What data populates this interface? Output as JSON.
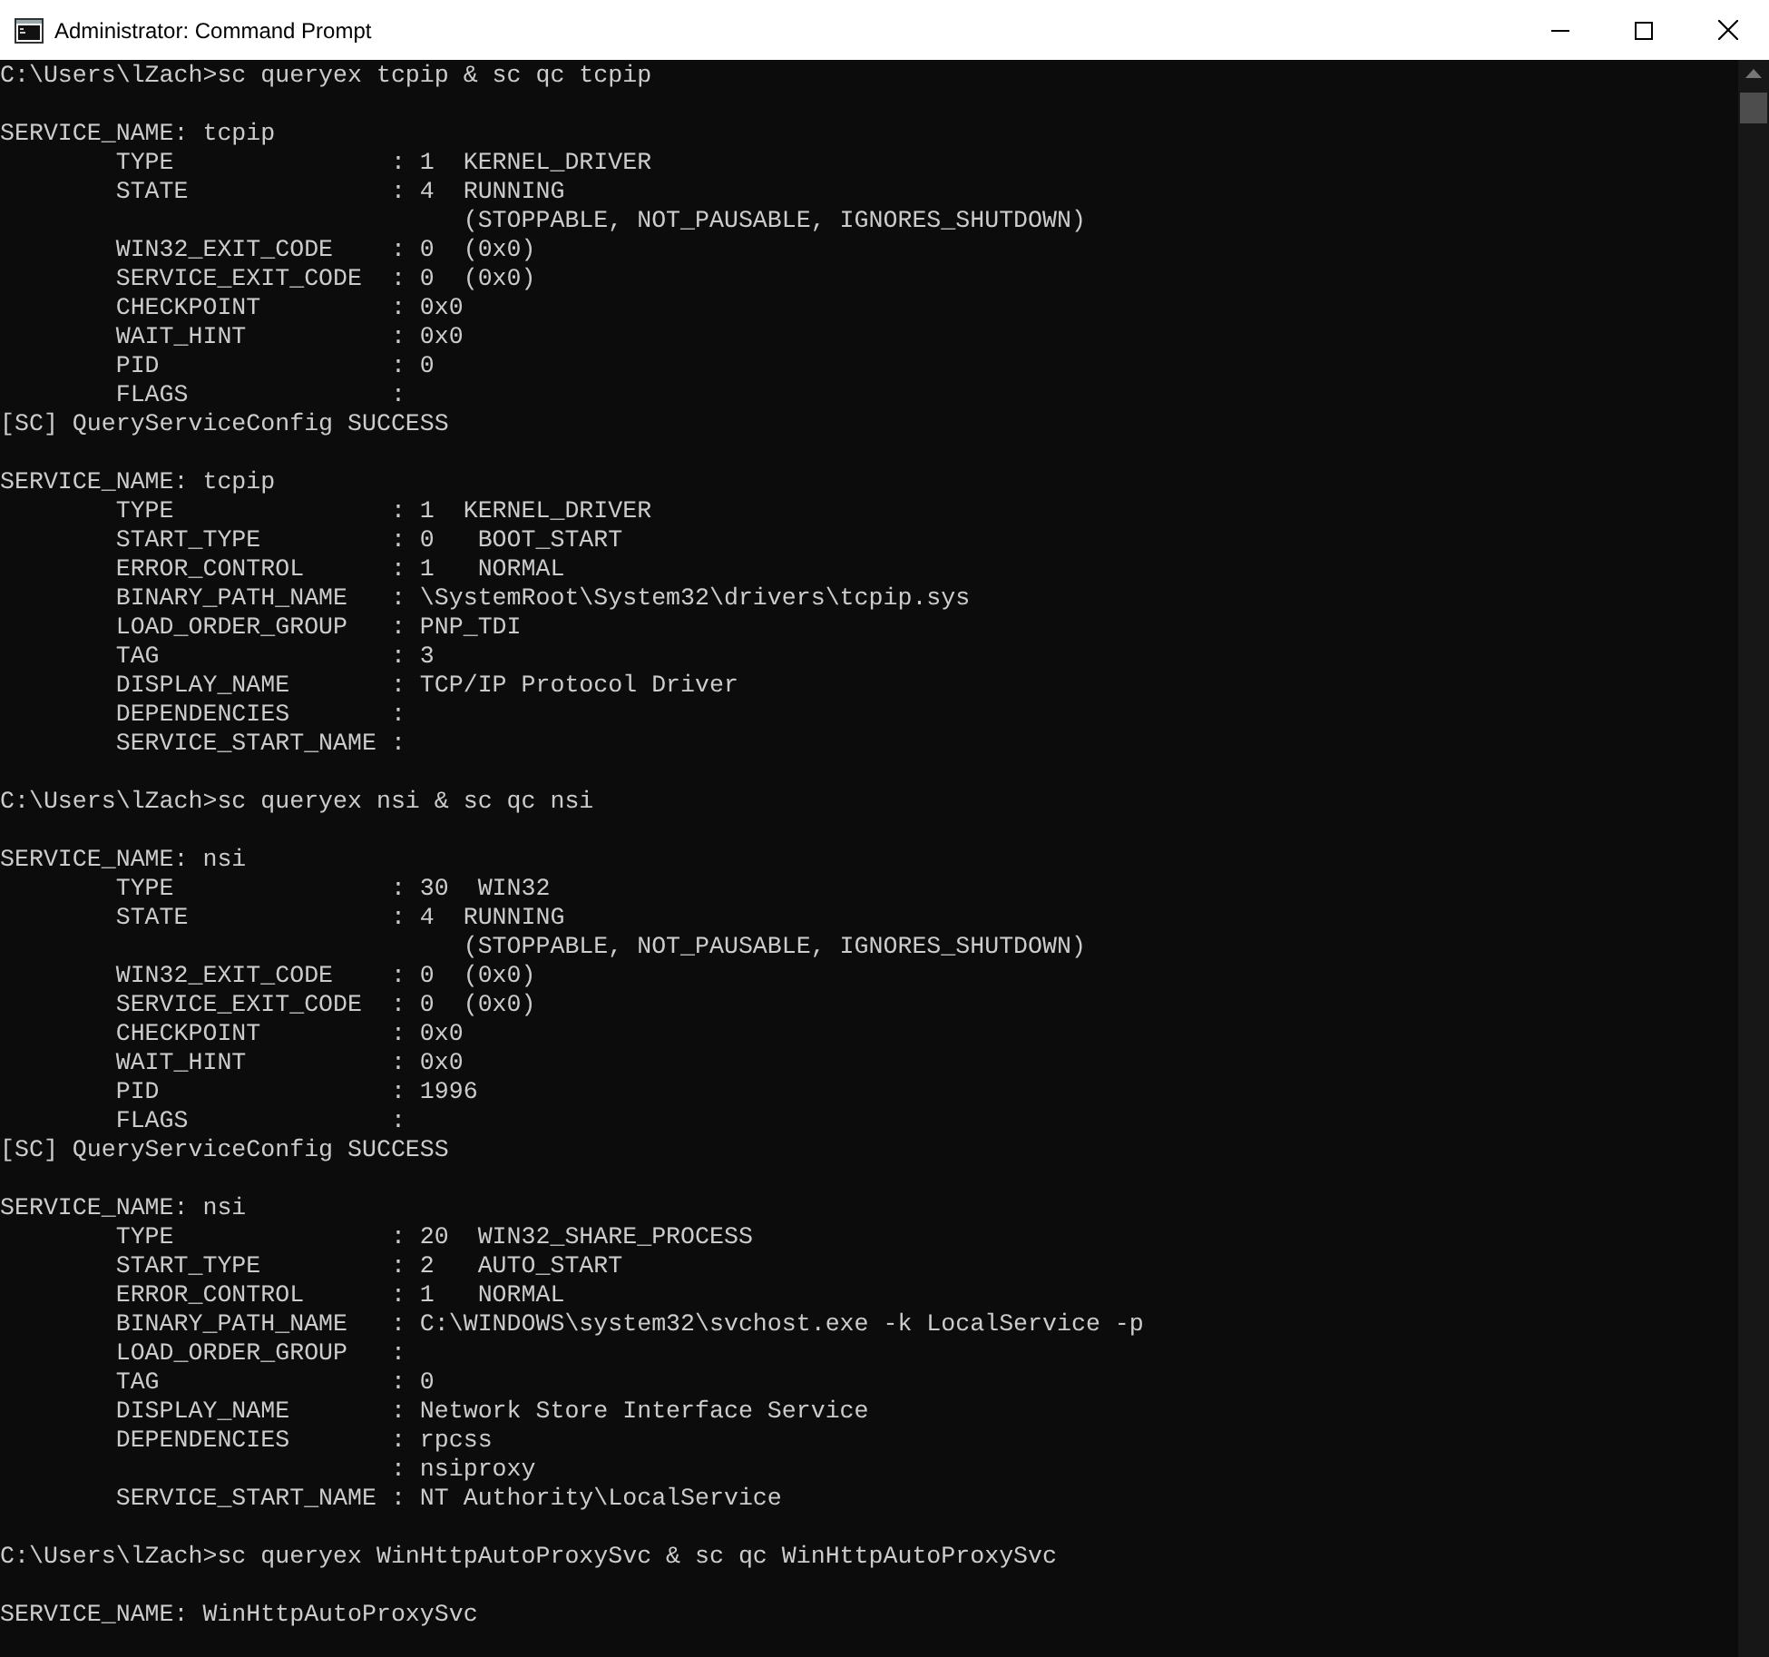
{
  "window": {
    "title": "Administrator: Command Prompt"
  },
  "console": {
    "blocks": [
      [
        "C:\\Users\\lZach>sc queryex tcpip & sc qc tcpip"
      ],
      [
        "SERVICE_NAME: tcpip",
        "        TYPE               : 1  KERNEL_DRIVER",
        "        STATE              : 4  RUNNING",
        "                                (STOPPABLE, NOT_PAUSABLE, IGNORES_SHUTDOWN)",
        "        WIN32_EXIT_CODE    : 0  (0x0)",
        "        SERVICE_EXIT_CODE  : 0  (0x0)",
        "        CHECKPOINT         : 0x0",
        "        WAIT_HINT          : 0x0",
        "        PID                : 0",
        "        FLAGS              :",
        "[SC] QueryServiceConfig SUCCESS"
      ],
      [
        "SERVICE_NAME: tcpip",
        "        TYPE               : 1  KERNEL_DRIVER",
        "        START_TYPE         : 0   BOOT_START",
        "        ERROR_CONTROL      : 1   NORMAL",
        "        BINARY_PATH_NAME   : \\SystemRoot\\System32\\drivers\\tcpip.sys",
        "        LOAD_ORDER_GROUP   : PNP_TDI",
        "        TAG                : 3",
        "        DISPLAY_NAME       : TCP/IP Protocol Driver",
        "        DEPENDENCIES       :",
        "        SERVICE_START_NAME :"
      ],
      [
        "C:\\Users\\lZach>sc queryex nsi & sc qc nsi"
      ],
      [
        "SERVICE_NAME: nsi",
        "        TYPE               : 30  WIN32",
        "        STATE              : 4  RUNNING",
        "                                (STOPPABLE, NOT_PAUSABLE, IGNORES_SHUTDOWN)",
        "        WIN32_EXIT_CODE    : 0  (0x0)",
        "        SERVICE_EXIT_CODE  : 0  (0x0)",
        "        CHECKPOINT         : 0x0",
        "        WAIT_HINT          : 0x0",
        "        PID                : 1996",
        "        FLAGS              :",
        "[SC] QueryServiceConfig SUCCESS"
      ],
      [
        "SERVICE_NAME: nsi",
        "        TYPE               : 20  WIN32_SHARE_PROCESS",
        "        START_TYPE         : 2   AUTO_START",
        "        ERROR_CONTROL      : 1   NORMAL",
        "        BINARY_PATH_NAME   : C:\\WINDOWS\\system32\\svchost.exe -k LocalService -p",
        "        LOAD_ORDER_GROUP   :",
        "        TAG                : 0",
        "        DISPLAY_NAME       : Network Store Interface Service",
        "        DEPENDENCIES       : rpcss",
        "                           : nsiproxy",
        "        SERVICE_START_NAME : NT Authority\\LocalService"
      ],
      [
        "C:\\Users\\lZach>sc queryex WinHttpAutoProxySvc & sc qc WinHttpAutoProxySvc"
      ],
      [
        "SERVICE_NAME: WinHttpAutoProxySvc"
      ]
    ]
  }
}
